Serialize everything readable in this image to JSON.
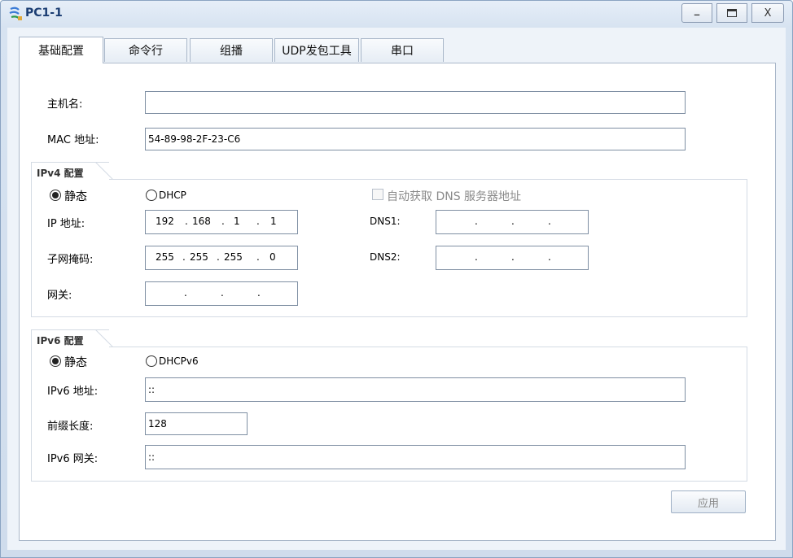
{
  "window": {
    "title": "PC1-1",
    "minimize_label": "_",
    "close_label": "X"
  },
  "tabs": [
    {
      "label": "基础配置"
    },
    {
      "label": "命令行"
    },
    {
      "label": "组播"
    },
    {
      "label": "UDP发包工具"
    },
    {
      "label": "串口"
    }
  ],
  "basic": {
    "hostname_label": "主机名:",
    "hostname_value": "",
    "mac_label": "MAC 地址:",
    "mac_value": "54-89-98-2F-23-C6"
  },
  "ipv4": {
    "group_title": "IPv4 配置",
    "static_label": "静态",
    "dhcp_label": "DHCP",
    "auto_dns_label": "自动获取 DNS 服务器地址",
    "ip_label": "IP 地址:",
    "ip": [
      "192",
      "168",
      "1",
      "1"
    ],
    "mask_label": "子网掩码:",
    "mask": [
      "255",
      "255",
      "255",
      "0"
    ],
    "gateway_label": "网关:",
    "dns1_label": "DNS1:",
    "dns2_label": "DNS2:",
    "dot": "."
  },
  "ipv6": {
    "group_title": "IPv6 配置",
    "static_label": "静态",
    "dhcpv6_label": "DHCPv6",
    "address_label": "IPv6 地址:",
    "address_value": "::",
    "prefix_label": "前缀长度:",
    "prefix_value": "128",
    "gateway_label": "IPv6 网关:",
    "gateway_value": "::"
  },
  "apply_label": "应用"
}
